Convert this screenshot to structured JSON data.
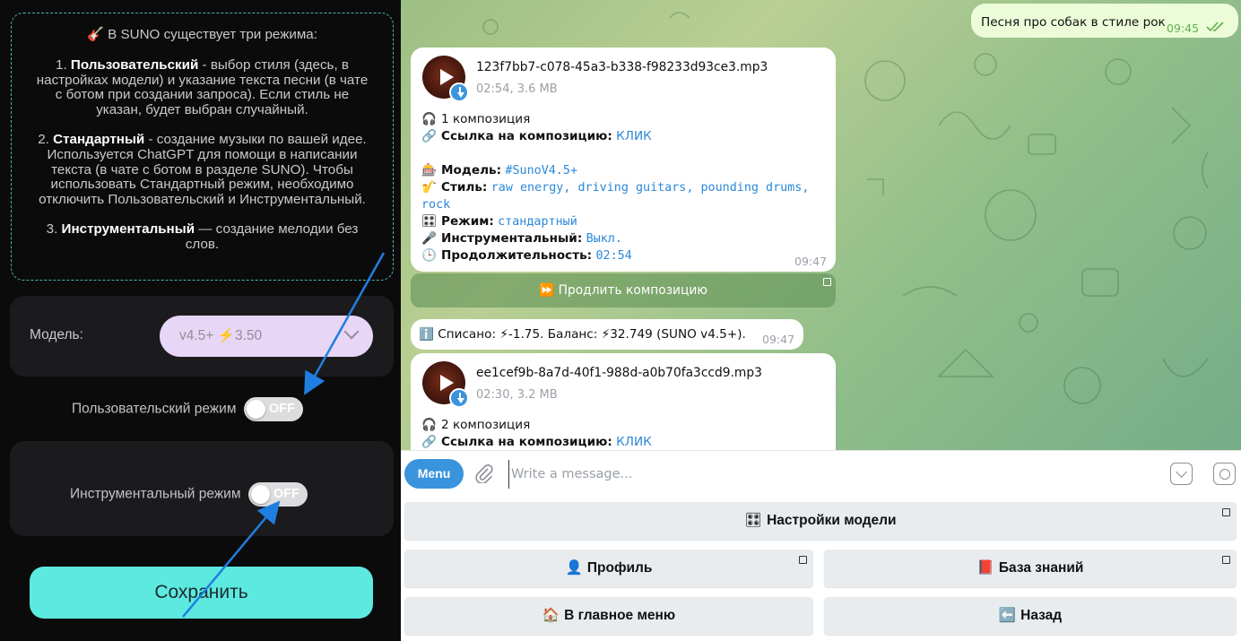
{
  "left_panel": {
    "info": {
      "title": "🎸 В SUNO существует три режима:",
      "modes": [
        {
          "num": "1.",
          "name": "Пользовательский",
          "desc": " - выбор стиля (здесь, в настройках модели) и указание текста песни (в чате с ботом при создании запроса). Если стиль не указан, будет выбран случайный."
        },
        {
          "num": "2.",
          "name": "Стандартный",
          "desc": " - создание музыки по вашей идее. Используется ChatGPT для помощи в написании текста (в чате с ботом в разделе SUNO). Чтобы использовать Стандартный режим, необходимо отключить Пользовательский и Инструментальный."
        },
        {
          "num": "3.",
          "name": "Инструментальный",
          "desc": " — создание мелодии без слов."
        }
      ]
    },
    "model_label": "Модель:",
    "model_value": "v4.5+ ⚡3.50",
    "custom_mode_label": "Пользовательский режим",
    "custom_mode_state": "OFF",
    "instrumental_label": "Инструментальный режим",
    "instrumental_state": "OFF",
    "save_label": "Сохранить",
    "colors": {
      "accent": "#5ce9e0",
      "select_bg": "#e8d6f7",
      "arrow": "#1f7fe0"
    }
  },
  "chat": {
    "outgoing": {
      "text": "Песня про собак в стиле рок",
      "time": "09:45"
    },
    "audio1": {
      "filename": "123f7bb7-c078-45a3-b338-f98233d93ce3.mp3",
      "meta": "02:54, 3.6 MB",
      "composition": "1 композиция",
      "link_label": "Ссылка на композицию:",
      "link_text": "КЛИК",
      "model_label": "Модель:",
      "model_value": "#SunoV4.5+",
      "style_label": "Стиль:",
      "style_value_1": "raw energy, driving guitars, pounding drums,",
      "style_value_2": "rock",
      "mode_label": "Режим:",
      "mode_value": "стандартный",
      "instr_label": "Инструментальный:",
      "instr_value": "Выкл.",
      "duration_label": "Продолжительность:",
      "duration_value": "02:54",
      "time": "09:47",
      "icons": {
        "composition": "🎧",
        "link": "🔗",
        "model": "🎰",
        "style": "🎷",
        "mode": "🎛",
        "instr": "🎤",
        "duration": "🕒"
      }
    },
    "extend_button": "⏩ Продлить композицию",
    "charged": {
      "text": "ℹ️ Списано: ⚡-1.75. Баланс: ⚡32.749 (SUNO v4.5+).",
      "time": "09:47"
    },
    "audio2": {
      "filename": "ee1cef9b-8a7d-40f1-988d-a0b70fa3ccd9.mp3",
      "meta": "02:30, 3.2 MB",
      "composition": "2 композиция",
      "link_label": "Ссылка на композицию:",
      "link_text": "КЛИК"
    }
  },
  "input": {
    "menu_label": "Menu",
    "placeholder": "Write a message..."
  },
  "keyboard": {
    "model_settings": {
      "icon": "🎛",
      "label": "Настройки модели"
    },
    "profile": {
      "icon": "👤",
      "label": "Профиль"
    },
    "knowledge": {
      "icon": "📕",
      "label": "База знаний"
    },
    "main_menu": {
      "icon": "🏠",
      "label": "В главное меню"
    },
    "back": {
      "icon": "⬅️",
      "label": "Назад"
    }
  }
}
